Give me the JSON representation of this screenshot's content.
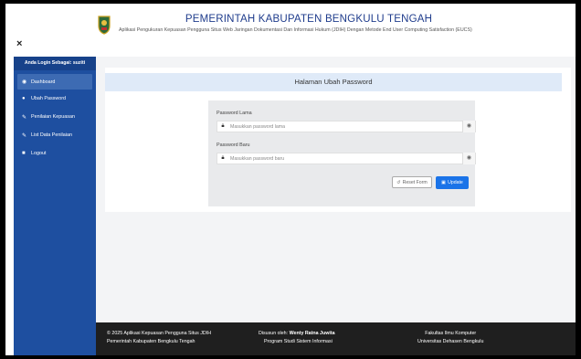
{
  "header": {
    "close_label": "×",
    "title": "PEMERINTAH KABUPATEN BENGKULU TENGAH",
    "subtitle": "Aplikasi Pengukuran Kepuasan Pengguna Situs Web Jaringan Dokumentasi Dan Informasi Hukum (JDIH) Dengan Metode End User Computing Satisfaction (EUCS)"
  },
  "sidebar": {
    "heading": "Anda Login Sebagai: suziti",
    "items": [
      {
        "icon": "dashboard-icon",
        "glyph": "◉",
        "label": "Dashboard",
        "active": true
      },
      {
        "icon": "user-icon",
        "glyph": "●",
        "label": "Ubah Password",
        "active": false
      },
      {
        "icon": "edit-icon",
        "glyph": "✎",
        "label": "Penilaian Kepuasan",
        "active": false
      },
      {
        "icon": "edit-icon",
        "glyph": "✎",
        "label": "List Data Penilaian",
        "active": false
      },
      {
        "icon": "logout-icon",
        "glyph": "■",
        "label": "Logout",
        "active": false
      }
    ]
  },
  "main": {
    "panel_title": "Halaman Ubah Password",
    "form": {
      "old_password_label": "Password Lama",
      "old_password_placeholder": "Masukkan password lama",
      "new_password_label": "Password Baru",
      "new_password_placeholder": "Masukkan password baru",
      "reset_label": "Reset Form",
      "update_label": "Update"
    }
  },
  "footer": {
    "left_line1": "© 2025 Aplikasi Kepuasan Pengguna Situs JDIH",
    "left_line2": "Pemerintah Kabupaten Bengkulu Tengah",
    "mid_prefix": "Disusun oleh:",
    "mid_name": "Wenty Ratna Juwita",
    "mid_line2": "Program Studi Sistem Informasi",
    "right_line1": "Fakultas Ilmu Komputer",
    "right_line2": "Universitas Dehasen Bengkulu"
  },
  "colors": {
    "sidebar": "#1e4fa0",
    "title": "#1f3c8c",
    "update_button": "#1a73e8",
    "footer": "#1f1f1f"
  }
}
